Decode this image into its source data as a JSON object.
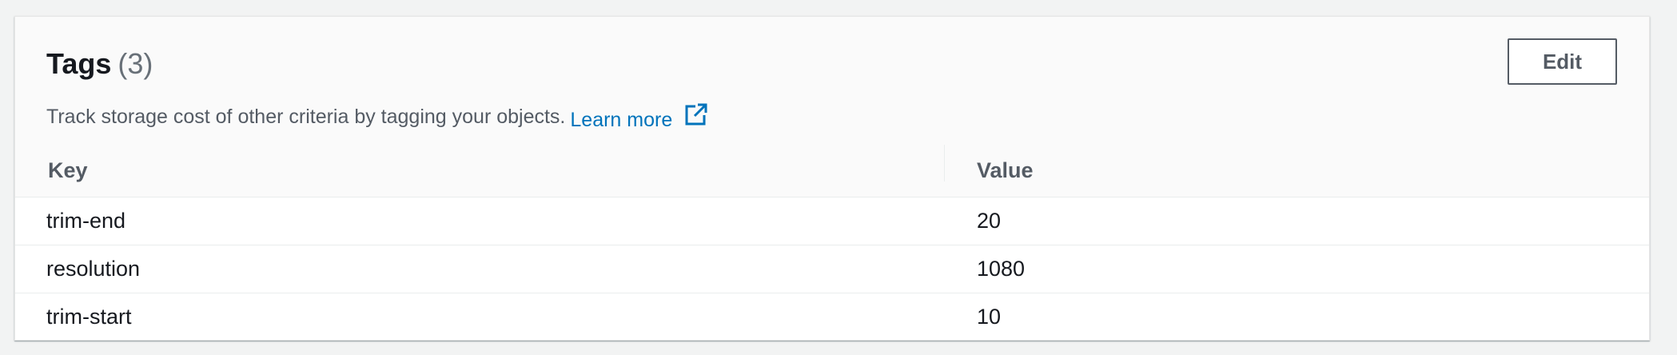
{
  "tags_panel": {
    "title": "Tags",
    "count": "(3)",
    "description": "Track storage cost of other criteria by tagging your objects.",
    "learn_more": "Learn more",
    "edit_label": "Edit",
    "columns": {
      "key": "Key",
      "value": "Value"
    },
    "rows": [
      {
        "key": "trim-end",
        "value": "20"
      },
      {
        "key": "resolution",
        "value": "1080"
      },
      {
        "key": "trim-start",
        "value": "10"
      }
    ],
    "link_color": "#0073bb"
  },
  "icons": {
    "external_link": "external-link-icon"
  }
}
